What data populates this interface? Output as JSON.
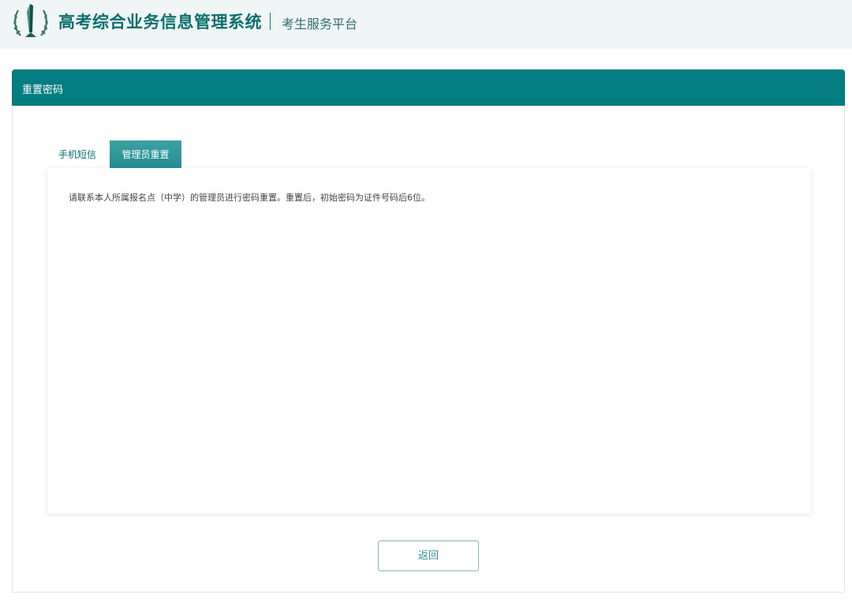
{
  "header": {
    "system_title": "高考综合业务信息管理系统",
    "platform_title": "考生服务平台",
    "logo_icon": "exam-emblem-icon"
  },
  "panel": {
    "title": "重置密码",
    "tabs": [
      {
        "label": "手机短信",
        "active": false
      },
      {
        "label": "管理员重置",
        "active": true
      }
    ],
    "notice": "请联系本人所属报名点（中学）的管理员进行密码重置。重置后，初始密码为证件号码后6位。",
    "back_label": "返回"
  },
  "colors": {
    "brand": "#037d80",
    "header_bg": "#f0f5f5",
    "tab_active": "#2a9295"
  }
}
